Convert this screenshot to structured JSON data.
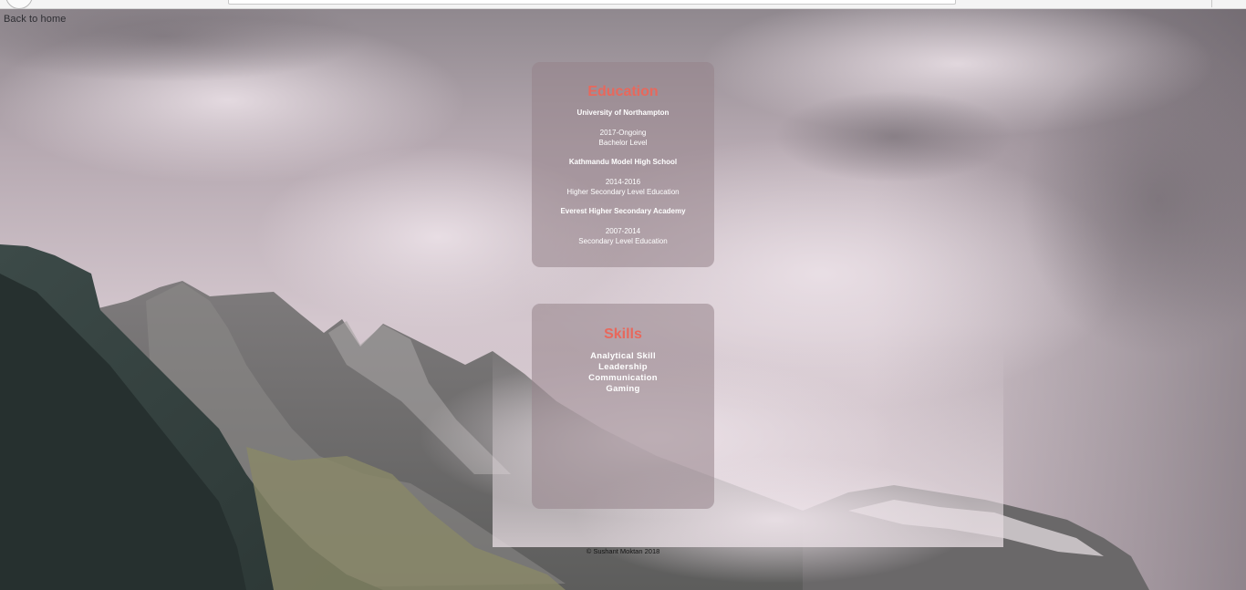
{
  "nav": {
    "back_label": "Back to home"
  },
  "education": {
    "title": "Education",
    "entries": [
      {
        "school": "University of Northampton",
        "years": "2017-Ongoing",
        "level": "Bachelor Level"
      },
      {
        "school": "Kathmandu Model High School",
        "years": "2014-2016",
        "level": "Higher Secondary Level Education"
      },
      {
        "school": "Everest Higher Secondary Academy",
        "years": "2007-2014",
        "level": "Secondary Level Education"
      }
    ]
  },
  "skills": {
    "title": "Skills",
    "items": [
      "Analytical Skill",
      "Leadership",
      "Communication",
      "Gaming"
    ]
  },
  "footer": {
    "text": "© Sushant Moktan 2018"
  },
  "colors": {
    "heading_accent": "#e8685c",
    "card_background": "rgba(150, 132, 138, 0.55)",
    "card_text": "#ffffff"
  }
}
